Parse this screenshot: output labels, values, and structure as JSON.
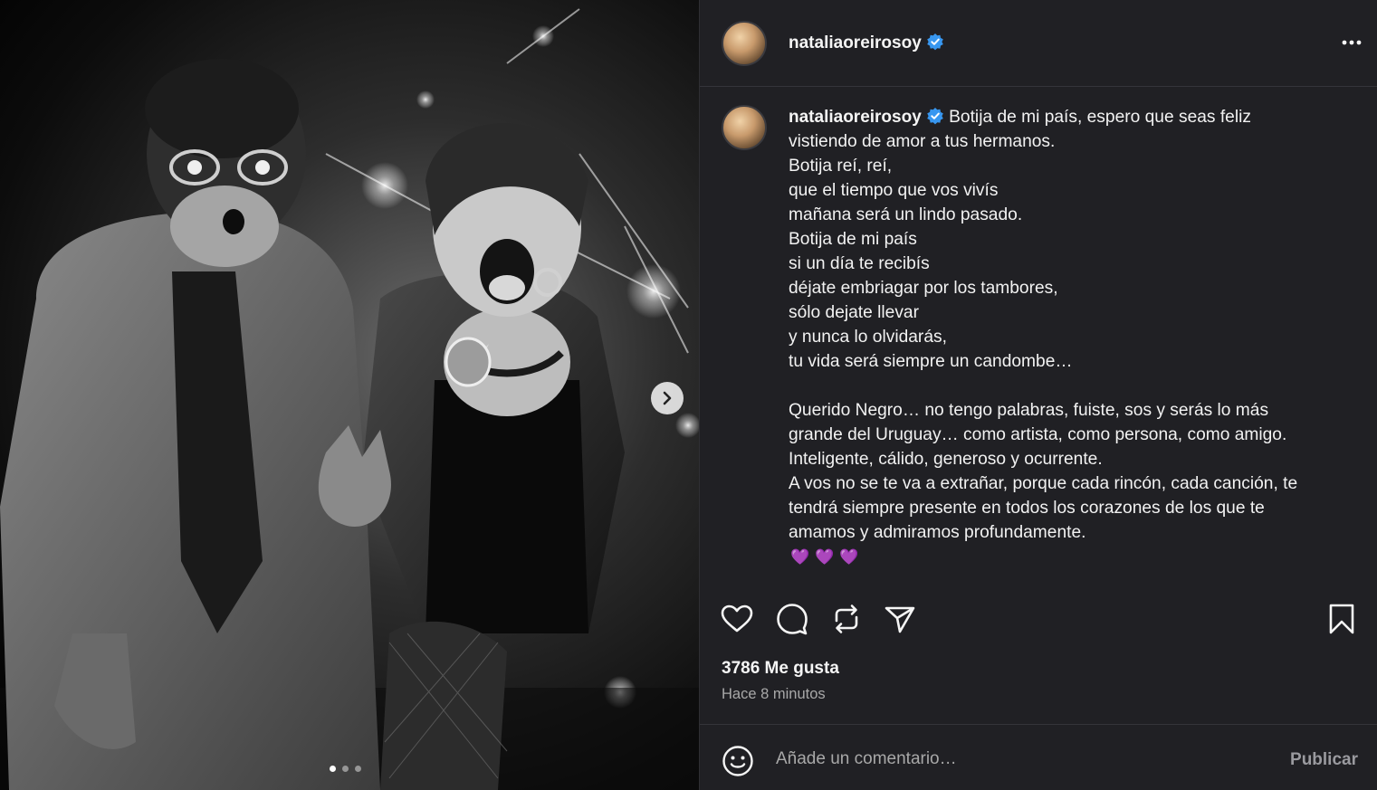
{
  "post": {
    "username": "nataliaoreirosoy",
    "verified": true,
    "caption_lines": [
      "Botija de mi país, espero que seas feliz",
      "vistiendo de amor a tus hermanos.",
      "Botija reí, reí,",
      "que el tiempo que vos vivís",
      "mañana será un lindo pasado.",
      "Botija de mi país",
      "si un día te recibís",
      "déjate embriagar por los tambores,",
      "sólo dejate llevar",
      "y nunca lo olvidarás,",
      "tu vida será siempre un candombe…",
      "",
      "Querido Negro… no tengo palabras, fuiste, sos y serás lo más",
      "grande del Uruguay… como artista, como persona, como amigo.",
      "Inteligente, cálido, generoso y ocurrente.",
      "A vos no se te va a extrañar, porque cada rincón, cada canción, te",
      "tendrá siempre presente en todos los corazones de los que te",
      "amamos y admiramos profundamente."
    ],
    "caption_emoji": "💜💜💜",
    "likes": "3786 Me gusta",
    "timestamp": "Hace 8 minutos"
  },
  "comment": {
    "placeholder": "Añade un comentario…",
    "publish_label": "Publicar"
  },
  "carousel": {
    "count": 3,
    "active_index": 0
  },
  "icons": {
    "header_more": "more-horizontal-icon",
    "like": "heart-icon",
    "comment": "comment-bubble-icon",
    "repost": "repost-icon",
    "share": "send-icon",
    "save": "bookmark-icon",
    "emoji": "smiley-icon",
    "next": "chevron-right-icon",
    "verified": "verified-badge-icon"
  },
  "colors": {
    "panel_bg": "#202024",
    "verified": "#3897f0",
    "text": "#f5f5f5",
    "muted": "#a8a8a8"
  }
}
